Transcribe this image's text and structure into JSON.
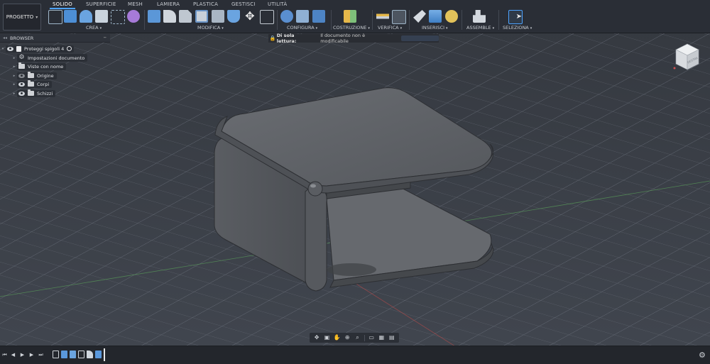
{
  "toolbar": {
    "project_button": "PROGETTO",
    "tabs": [
      {
        "label": "SOLIDO",
        "active": true
      },
      {
        "label": "SUPERFICIE",
        "active": false
      },
      {
        "label": "MESH",
        "active": false
      },
      {
        "label": "LAMIERA",
        "active": false
      },
      {
        "label": "PLASTICA",
        "active": false
      },
      {
        "label": "GESTISCI",
        "active": false
      },
      {
        "label": "UTILITÀ",
        "active": false
      }
    ],
    "groups": {
      "crea": "CREA",
      "modifica": "MODIFICA",
      "configura": "CONFIGURA",
      "costruzione": "COSTRUZIONE",
      "verifica": "VERIFICA",
      "inserisci": "INSERISCI",
      "assemble": "ASSEMBLE",
      "seleziona": "SELEZIONA"
    },
    "accent_color": "#4da3ff"
  },
  "browser": {
    "title": "BROWSER",
    "root_label": "Proteggi spigoli 4",
    "items": [
      {
        "label": "Impostazioni documento",
        "icon": "gear-icon"
      },
      {
        "label": "Viste con nome",
        "icon": "folder-icon"
      },
      {
        "label": "Origine",
        "icon": "folder-icon"
      },
      {
        "label": "Corpi",
        "icon": "folder-icon"
      },
      {
        "label": "Schizzi",
        "icon": "folder-icon"
      }
    ]
  },
  "banner": {
    "label": "Di sola lettura:",
    "message": "Il documento non è modificabile",
    "warning_color": "#f0a500"
  },
  "viewcube": {
    "face_label": "DESTRA"
  },
  "viewport": {
    "background": "#3a3f4b",
    "grid_color": "#7a808c",
    "model_color": "#5d6066"
  }
}
